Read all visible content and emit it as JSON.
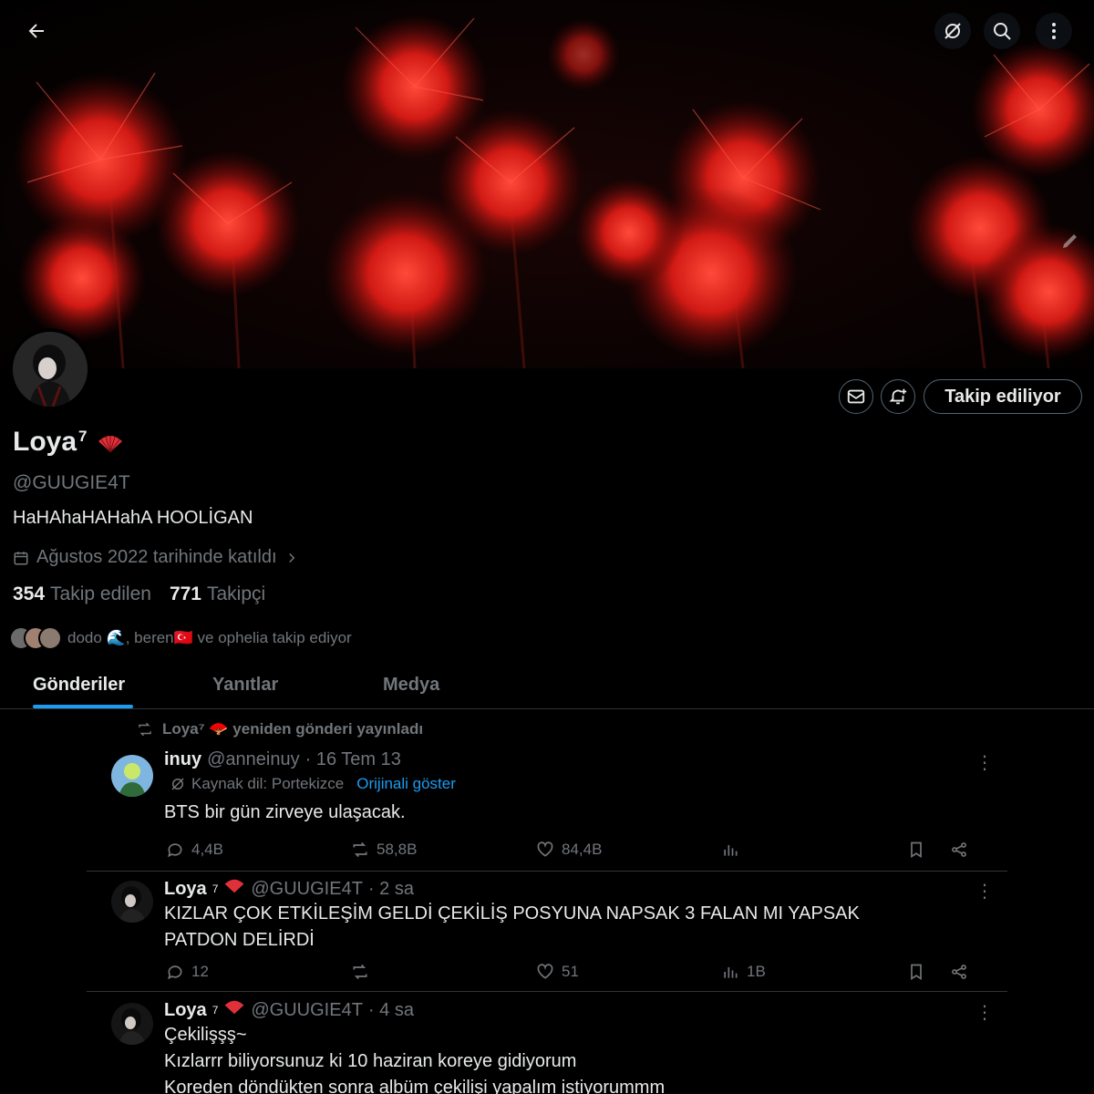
{
  "header": {
    "back_icon": "arrow-left-icon",
    "translate_icon": "translate-icon",
    "search_icon": "search-icon",
    "more_icon": "more-vertical-icon",
    "edit_icon": "pencil-icon"
  },
  "profile": {
    "display_name": "Loya",
    "name_superscript": "7",
    "emoji": "fan-icon",
    "handle": "@GUUGIE4T",
    "bio": "HaHAhaHAHahA HOOLİGAN",
    "joined": "Ağustos 2022 tarihinde katıldı",
    "following_count": "354",
    "following_label": "Takip edilen",
    "followers_count": "771",
    "followers_label": "Takipçi",
    "followed_by_text": "dodo 🌊, beren🇹🇷 ve ophelia takip ediyor",
    "follow_button": "Takip ediliyor",
    "accent_color": "#1d9bf0"
  },
  "tabs": [
    {
      "label": "Gönderiler",
      "active": true
    },
    {
      "label": "Yanıtlar",
      "active": false
    },
    {
      "label": "Medya",
      "active": false
    }
  ],
  "posts": [
    {
      "repost_label": "Loya⁷ 🪭 yeniden gönderi yayınladı",
      "author": "inuy",
      "handle": "@anneinuy",
      "time": "· 16 Tem 13",
      "translate_label": "Kaynak dil: Portekizce",
      "translate_link": "Orijinali göster",
      "text": "BTS bir gün zirveye ulaşacak.",
      "replies": "4,4B",
      "reposts": "58,8B",
      "likes": "84,4B",
      "views": ""
    },
    {
      "author": "Loya",
      "author_sup": "7",
      "handle": "@GUUGIE4T",
      "time": "· 2 sa",
      "text_lines": [
        "KIZLAR ÇOK ETKİLEŞİM GELDİ ÇEKİLİŞ POSYUNA NAPSAK 3 FALAN MI YAPSAK",
        "PATDON DELİRDİ"
      ],
      "replies": "12",
      "reposts": "",
      "likes": "51",
      "views": "1B"
    },
    {
      "author": "Loya",
      "author_sup": "7",
      "handle": "@GUUGIE4T",
      "time": "· 4 sa",
      "text_lines": [
        "Çekilişşş~",
        "Kızlarrr biliyorsunuz ki 10 haziran koreye gidiyorum",
        "Koreden döndükten sonra albüm çekilişi yapalım istiyorummm"
      ]
    }
  ]
}
